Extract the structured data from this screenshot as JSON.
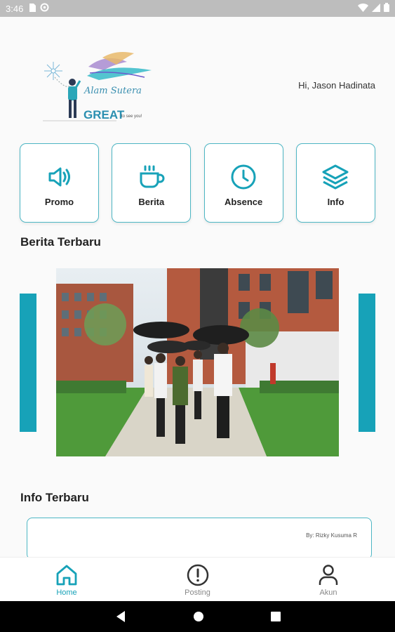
{
  "status_bar": {
    "time": "3:46"
  },
  "header": {
    "logo_script": "Alam Sutera",
    "logo_great": "GREAT",
    "logo_tagline": "to see you!",
    "greeting": "Hi, Jason Hadinata"
  },
  "menu": [
    {
      "label": "Promo",
      "icon": "speaker-icon"
    },
    {
      "label": "Berita",
      "icon": "coffee-cup-icon"
    },
    {
      "label": "Absence",
      "icon": "clock-icon"
    },
    {
      "label": "Info",
      "icon": "layers-icon"
    }
  ],
  "news": {
    "title": "Berita Terbaru"
  },
  "info": {
    "title": "Info Terbaru",
    "author": "By: Rizky Kusuma R"
  },
  "bottom_nav": [
    {
      "label": "Home",
      "icon": "home-icon",
      "active": true
    },
    {
      "label": "Posting",
      "icon": "alert-circle-icon",
      "active": false
    },
    {
      "label": "Akun",
      "icon": "user-icon",
      "active": false
    }
  ],
  "colors": {
    "accent": "#17a2b8",
    "border": "#4db6c4",
    "inactive": "#888888"
  }
}
